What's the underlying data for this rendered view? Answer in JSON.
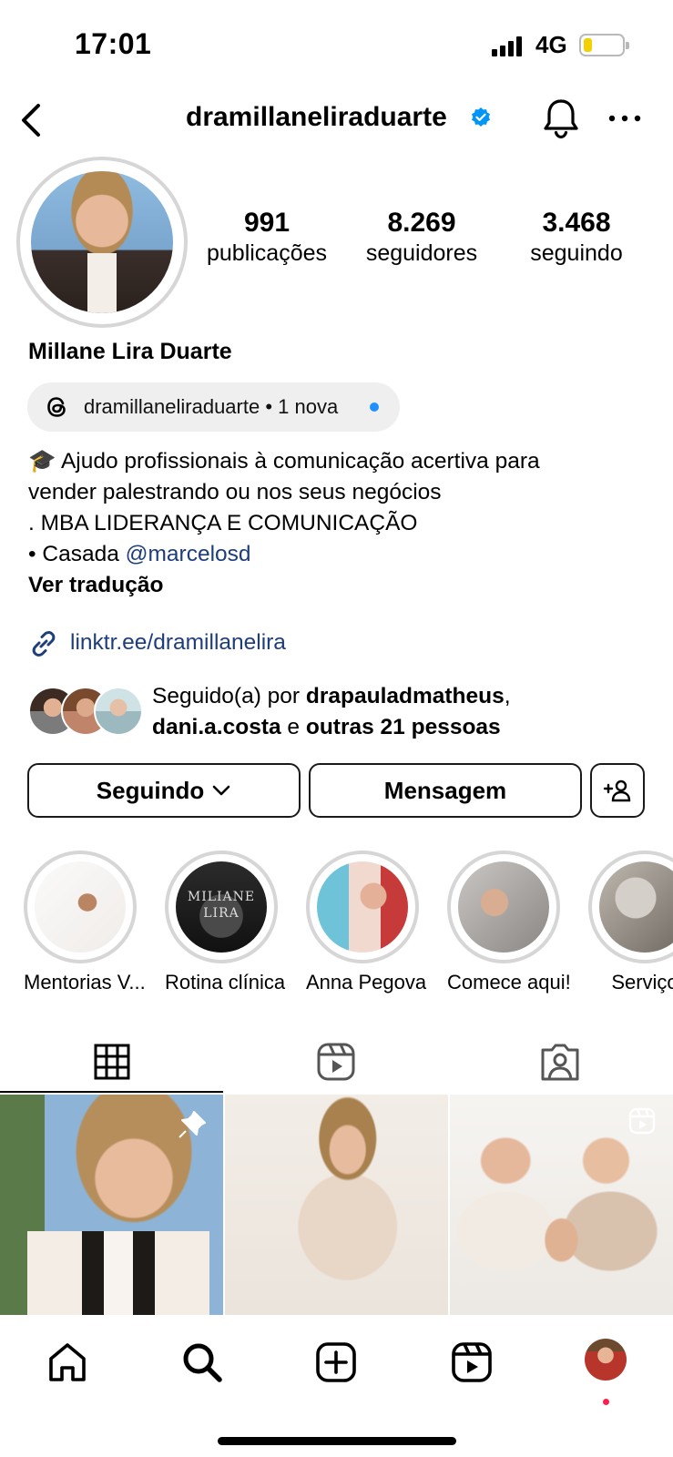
{
  "status_bar": {
    "time": "17:01",
    "network": "4G"
  },
  "header": {
    "username": "dramillaneliraduarte",
    "verified": true
  },
  "profile": {
    "stats": [
      {
        "value": "991",
        "label": "publicações"
      },
      {
        "value": "8.269",
        "label": "seguidores"
      },
      {
        "value": "3.468",
        "label": "seguindo"
      }
    ],
    "full_name": "Millane Lira Duarte",
    "threads": {
      "text": "dramillaneliraduarte • 1 nova"
    },
    "bio": {
      "line1": "🎓 Ajudo profissionais à comunicação acertiva para",
      "line2": "vender palestrando ou nos seus negócios",
      "line3": ". MBA LIDERANÇA E COMUNICAÇÃO",
      "line4_prefix": "• Casada ",
      "line4_mention": "@marcelosd",
      "translate": "Ver tradução"
    },
    "link": "linktr.ee/dramillanelira",
    "followed_by": {
      "prefix": "Seguido(a) por ",
      "user1": "drapauladmatheus",
      "comma": ",",
      "user2": "dani.a.costa",
      "conj": " e ",
      "others": "outras 21 pessoas"
    }
  },
  "buttons": {
    "following": "Seguindo",
    "message": "Mensagem"
  },
  "highlights": [
    {
      "label": "Mentorias V..."
    },
    {
      "label": "Rotina clínica",
      "overlay": "MILIANE LIRA"
    },
    {
      "label": "Anna Pegova"
    },
    {
      "label": "Comece aqui!"
    },
    {
      "label": "Serviço"
    }
  ],
  "tabs": [
    "grid",
    "reels",
    "tagged"
  ],
  "colors": {
    "link": "#1d3d7b",
    "verified": "#0095f6",
    "battery": "#f3d000",
    "notification": "#ff1f4b"
  }
}
